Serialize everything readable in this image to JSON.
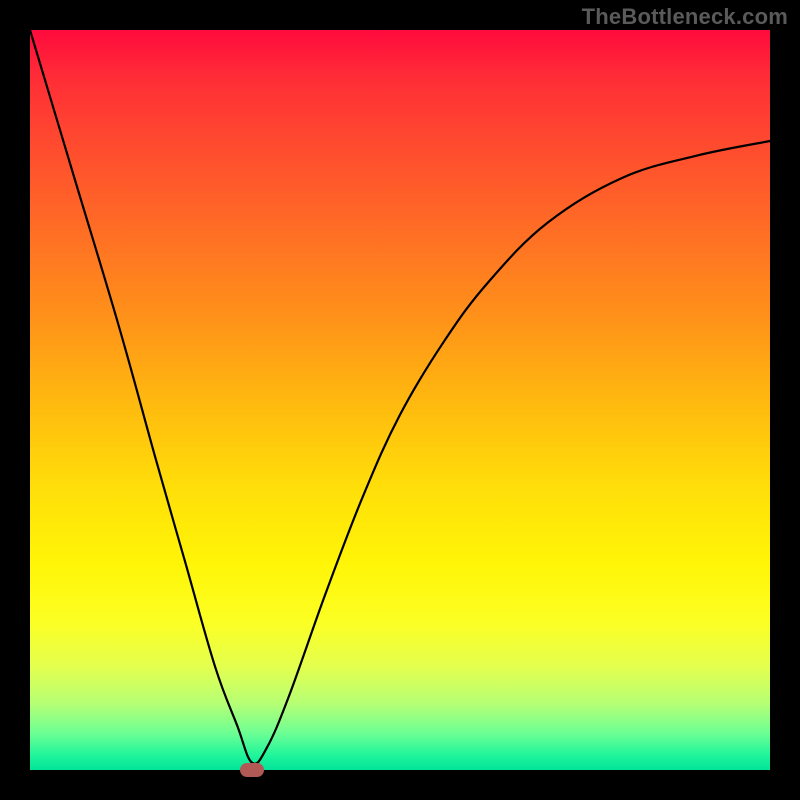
{
  "watermark": "TheBottleneck.com",
  "chart_data": {
    "type": "line",
    "title": "",
    "xlabel": "",
    "ylabel": "",
    "xlim": [
      0,
      100
    ],
    "ylim": [
      0,
      100
    ],
    "grid": false,
    "legend": false,
    "background_gradient": {
      "orientation": "vertical",
      "stops": [
        {
          "pos": 0.0,
          "color": "#ff0a3d"
        },
        {
          "pos": 0.5,
          "color": "#ffb80f"
        },
        {
          "pos": 0.8,
          "color": "#fcff23"
        },
        {
          "pos": 1.0,
          "color": "#00e39a"
        }
      ]
    },
    "series": [
      {
        "name": "bottleneck-curve",
        "x": [
          0,
          6,
          12,
          17,
          21,
          25,
          28,
          30,
          32,
          35,
          40,
          45,
          50,
          56,
          62,
          70,
          80,
          90,
          100
        ],
        "y": [
          100,
          80,
          60,
          42,
          28,
          14,
          6,
          1,
          3,
          10,
          24,
          37,
          48,
          58,
          66,
          74,
          80,
          83,
          85
        ]
      }
    ],
    "marker": {
      "name": "optimal-point",
      "x": 30,
      "y": 0,
      "color": "#b15954",
      "shape": "pill"
    }
  }
}
